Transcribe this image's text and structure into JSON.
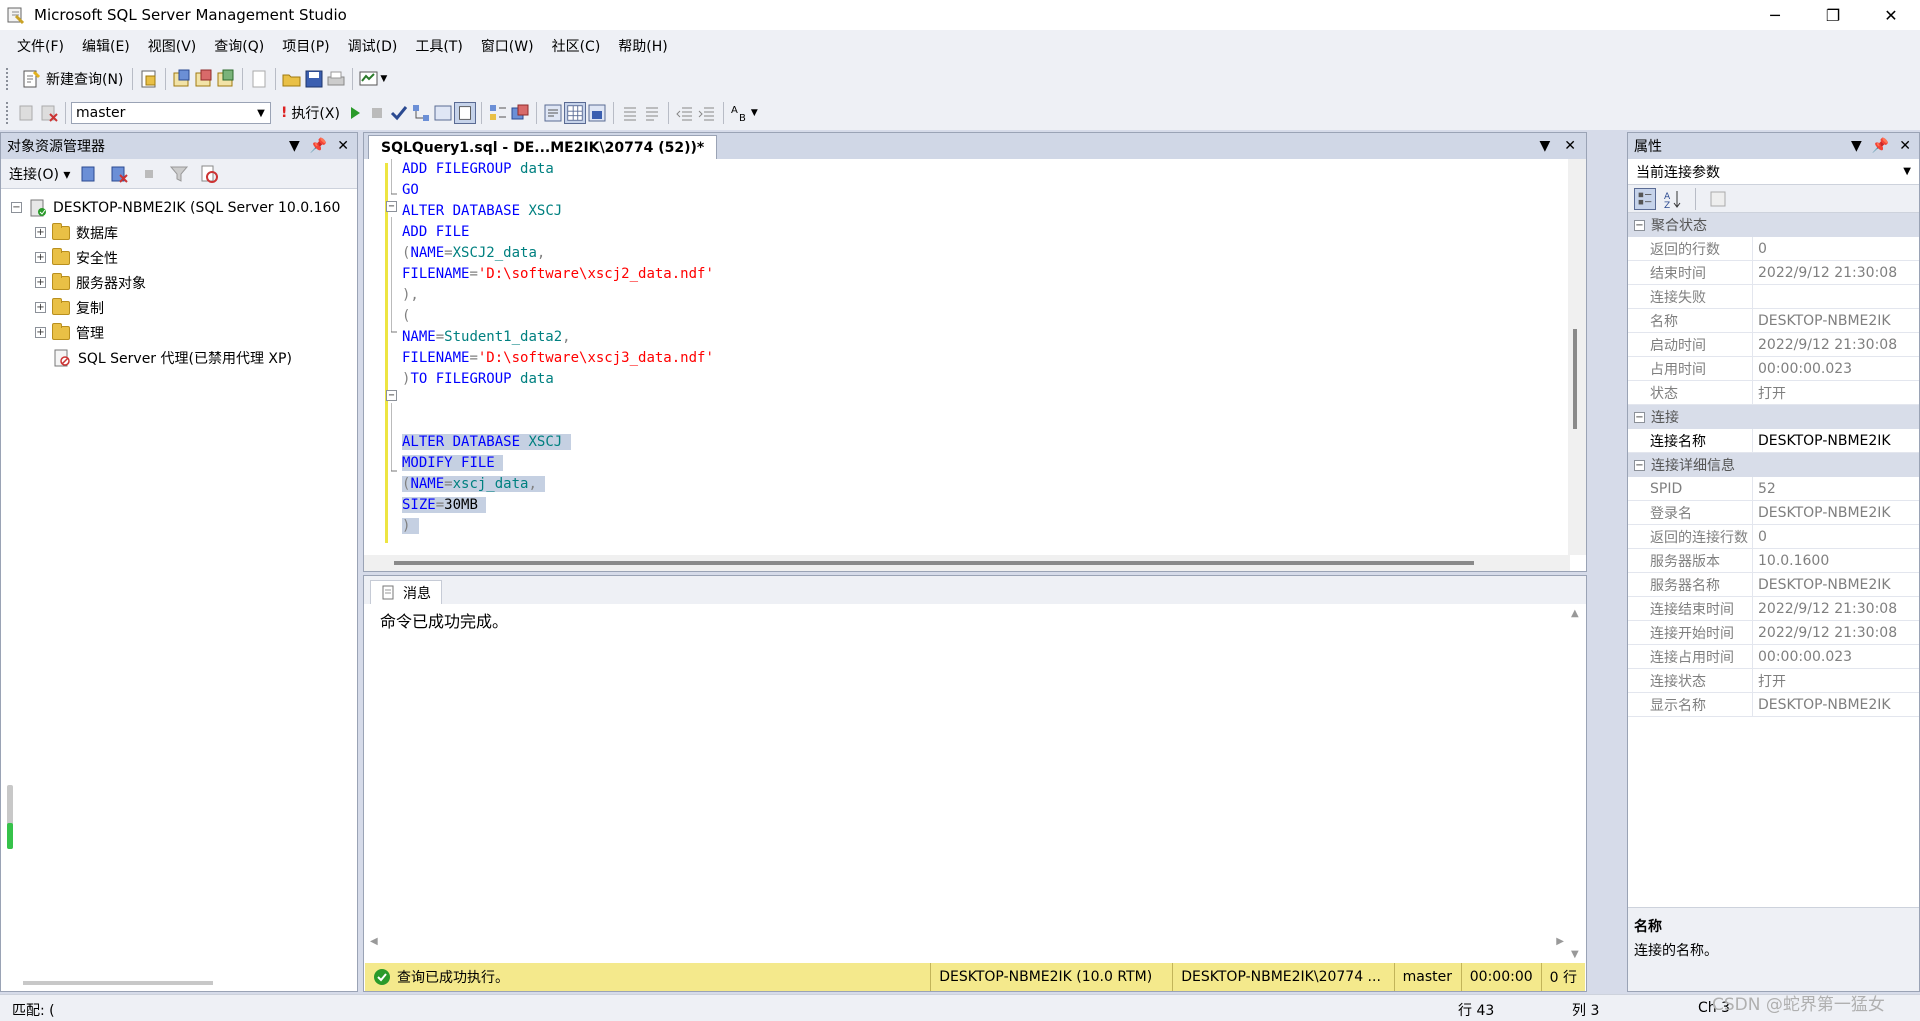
{
  "window": {
    "title": "Microsoft SQL Server Management Studio",
    "buttons": [
      "─",
      "❐",
      "✕"
    ]
  },
  "menu": [
    "文件(F)",
    "编辑(E)",
    "视图(V)",
    "查询(Q)",
    "项目(P)",
    "调试(D)",
    "工具(T)",
    "窗口(W)",
    "社区(C)",
    "帮助(H)"
  ],
  "toolbar1": {
    "new_query": "新建查询(N)"
  },
  "toolbar2": {
    "database": "master",
    "execute": "执行(X)"
  },
  "object_explorer": {
    "title": "对象资源管理器",
    "connect": "连接(O)",
    "server": "DESKTOP-NBME2IK (SQL Server 10.0.160",
    "nodes": [
      {
        "label": "数据库"
      },
      {
        "label": "安全性"
      },
      {
        "label": "服务器对象"
      },
      {
        "label": "复制"
      },
      {
        "label": "管理"
      }
    ],
    "agent": "SQL Server 代理(已禁用代理 XP)"
  },
  "editor": {
    "tab_title": "SQLQuery1.sql - DE...ME2IK\\20774 (52))*"
  },
  "results": {
    "tab": "消息",
    "message": "命令已成功完成。"
  },
  "query_status": {
    "text": "查询已成功执行。",
    "server": "DESKTOP-NBME2IK (10.0 RTM)",
    "user": "DESKTOP-NBME2IK\\20774 ...",
    "db": "master",
    "time": "00:00:00",
    "rows": "0 行"
  },
  "properties": {
    "title": "属性",
    "combo": "当前连接参数",
    "categories": [
      {
        "name": "聚合状态",
        "rows": [
          {
            "name": "返回的行数",
            "value": "0"
          },
          {
            "name": "结束时间",
            "value": "2022/9/12 21:30:08"
          },
          {
            "name": "连接失败",
            "value": ""
          },
          {
            "name": "名称",
            "value": "DESKTOP-NBME2IK"
          },
          {
            "name": "启动时间",
            "value": "2022/9/12 21:30:08"
          },
          {
            "name": "占用时间",
            "value": "00:00:00.023"
          },
          {
            "name": "状态",
            "value": "打开"
          }
        ]
      },
      {
        "name": "连接",
        "rows": [
          {
            "name": "连接名称",
            "value": "DESKTOP-NBME2IK"
          }
        ]
      },
      {
        "name": "连接详细信息",
        "rows": [
          {
            "name": "SPID",
            "value": "52"
          },
          {
            "name": "登录名",
            "value": "DESKTOP-NBME2IK"
          },
          {
            "name": "返回的连接行数",
            "value": "0"
          },
          {
            "name": "服务器版本",
            "value": "10.0.1600"
          },
          {
            "name": "服务器名称",
            "value": "DESKTOP-NBME2IK"
          },
          {
            "name": "连接结束时间",
            "value": "2022/9/12 21:30:08"
          },
          {
            "name": "连接开始时间",
            "value": "2022/9/12 21:30:08"
          },
          {
            "name": "连接占用时间",
            "value": "00:00:00.023"
          },
          {
            "name": "连接状态",
            "value": "打开"
          },
          {
            "name": "显示名称",
            "value": "DESKTOP-NBME2IK"
          }
        ]
      }
    ],
    "desc_title": "名称",
    "desc_text": "连接的名称。"
  },
  "statusbar": {
    "left": "匹配: (",
    "row": "行 43",
    "col": "列 3",
    "ch": "Ch 3"
  },
  "watermark": "CSDN @蛇界第一猛女"
}
